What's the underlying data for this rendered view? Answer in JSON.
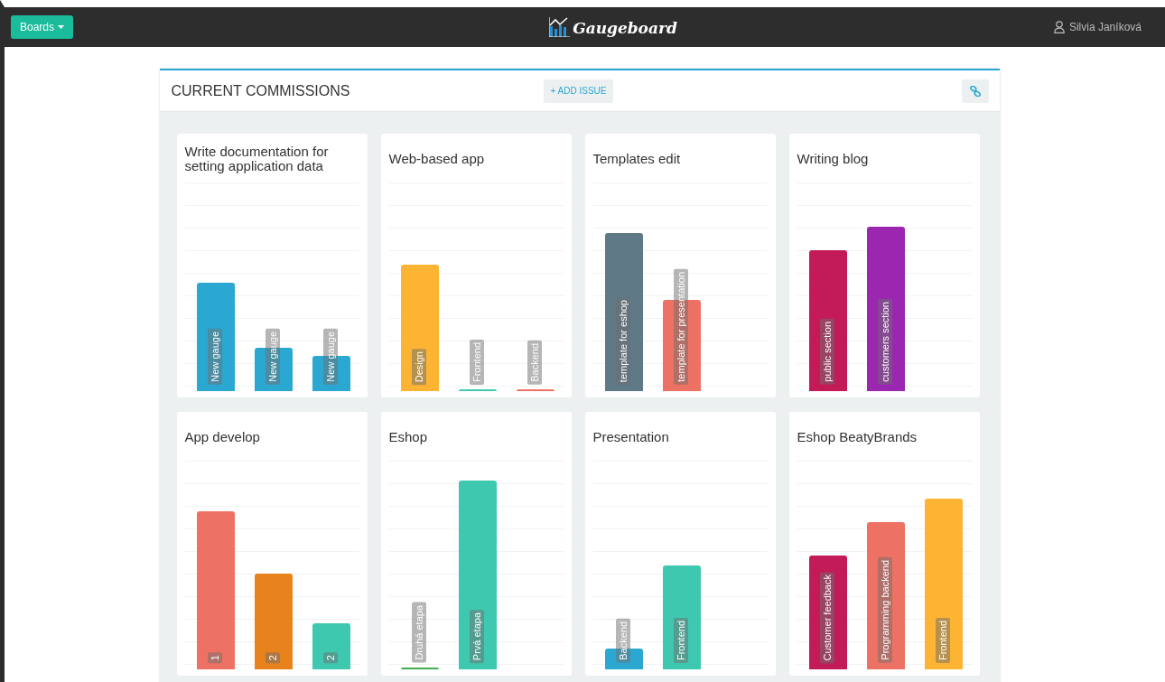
{
  "navbar": {
    "menu_button": "Boards",
    "logo": "Gaugeboard",
    "user": "Silvia Janíková"
  },
  "panel": {
    "title": "CURRENT COMMISSIONS",
    "add_button": "+ ADD ISSUE"
  },
  "boards": [
    {
      "title": "Write documentation for setting application data",
      "gauges": [
        {
          "label": "New gauge",
          "level": 0.52,
          "color": "#2aa8d2"
        },
        {
          "label": "New gauge",
          "level": 0.21,
          "color": "#2aa8d2"
        },
        {
          "label": "New gauge",
          "level": 0.17,
          "color": "#2aa8d2"
        }
      ]
    },
    {
      "title": "Web-based app",
      "gauges": [
        {
          "label": "Design",
          "level": 0.61,
          "color": "#fdb432"
        },
        {
          "label": "Frontend",
          "level": 0.01,
          "color": "#3ec8b0"
        },
        {
          "label": "Backend",
          "level": 0.01,
          "color": "#ee7263"
        }
      ]
    },
    {
      "title": "Templates edit",
      "gauges": [
        {
          "label": "template for eshop",
          "level": 0.76,
          "color": "#5f7986"
        },
        {
          "label": "template for presentation",
          "level": 0.44,
          "color": "#ee7263"
        }
      ]
    },
    {
      "title": "Writing blog",
      "gauges": [
        {
          "label": "public section",
          "level": 0.68,
          "color": "#c31a58"
        },
        {
          "label": "customers section",
          "level": 0.79,
          "color": "#9b27b0"
        }
      ]
    },
    {
      "title": "App develop",
      "gauges": [
        {
          "label": "1",
          "level": 0.76,
          "color": "#ee7263"
        },
        {
          "label": "2",
          "level": 0.46,
          "color": "#e8821c"
        },
        {
          "label": "2",
          "level": 0.22,
          "color": "#3ec8b0"
        }
      ]
    },
    {
      "title": "Eshop",
      "gauges": [
        {
          "label": "Druhá etapa",
          "level": 0.01,
          "color": "#43ad4c"
        },
        {
          "label": "Prvá etapa",
          "level": 0.91,
          "color": "#3ec8b0"
        }
      ]
    },
    {
      "title": "Presentation",
      "gauges": [
        {
          "label": "Backend",
          "level": 0.1,
          "color": "#2aa8d2"
        },
        {
          "label": "Frontend",
          "level": 0.5,
          "color": "#3ec8b0"
        }
      ]
    },
    {
      "title": "Eshop BeatyBrands",
      "gauges": [
        {
          "label": "Customer feedback",
          "level": 0.55,
          "color": "#c31a58"
        },
        {
          "label": "Programming backend",
          "level": 0.71,
          "color": "#ee7263"
        },
        {
          "label": "Frontend",
          "level": 0.82,
          "color": "#fdb432"
        }
      ]
    }
  ]
}
